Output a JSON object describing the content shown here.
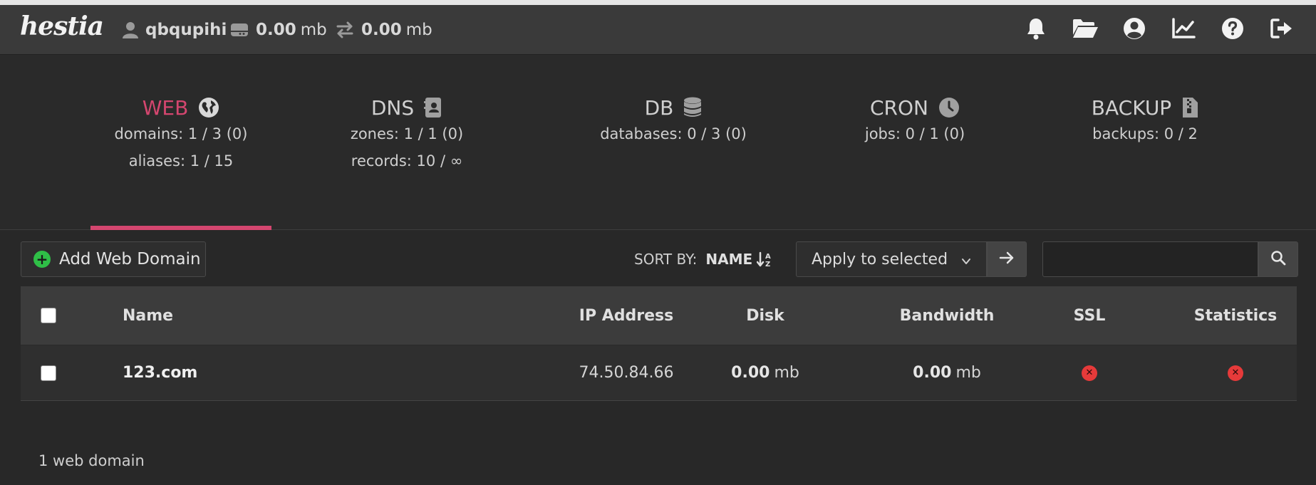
{
  "app": {
    "logo_text": "hestia"
  },
  "topbar": {
    "username": "qbqupihi",
    "disk_value": "0.00",
    "disk_unit": "mb",
    "bandwidth_value": "0.00",
    "bandwidth_unit": "mb",
    "icons": [
      "user-icon",
      "hdd-icon",
      "transfer-icon",
      "bell-icon",
      "folder-open-icon",
      "user-circle-icon",
      "chart-line-icon",
      "question-circle-icon",
      "logout-icon"
    ]
  },
  "stats": [
    {
      "title": "WEB",
      "icon": "globe-icon",
      "lines": [
        "domains: 1 / 3 (0)",
        "aliases: 1 / 15"
      ]
    },
    {
      "title": "DNS",
      "icon": "address-book-icon",
      "lines": [
        "zones: 1 / 1 (0)",
        "records: 10 / ∞"
      ]
    },
    {
      "title": "DB",
      "icon": "database-icon",
      "lines": [
        "databases: 0 / 3 (0)"
      ]
    },
    {
      "title": "CRON",
      "icon": "clock-icon",
      "lines": [
        "jobs: 0 / 1 (0)"
      ]
    },
    {
      "title": "BACKUP",
      "icon": "file-archive-icon",
      "lines": [
        "backups: 0 / 2"
      ]
    }
  ],
  "colors": {
    "accent": "#d4466f",
    "add_green": "#2fbf47",
    "error_red": "#e63a3a"
  },
  "toolbar": {
    "add_label": "Add Web Domain",
    "sort_label": "SORT BY:",
    "sort_field": "NAME",
    "apply_select": "Apply to selected",
    "search_placeholder": ""
  },
  "table": {
    "headers": {
      "name": "Name",
      "ip": "IP Address",
      "disk": "Disk",
      "bandwidth": "Bandwidth",
      "ssl": "SSL",
      "statistics": "Statistics"
    },
    "rows": [
      {
        "name": "123.com",
        "ip": "74.50.84.66",
        "disk_value": "0.00",
        "disk_unit": "mb",
        "bandwidth_value": "0.00",
        "bandwidth_unit": "mb",
        "ssl": "disabled",
        "statistics": "disabled"
      }
    ]
  },
  "footer": {
    "count_text": "1 web domain"
  }
}
